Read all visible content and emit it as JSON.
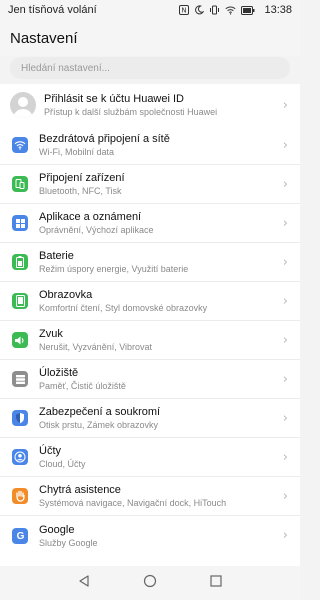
{
  "status_bar": {
    "carrier": "Jen tísňová volání",
    "time": "13:38",
    "icons": [
      "nfc-icon",
      "moon-icon",
      "vibrate-icon",
      "wifi-icon",
      "battery-icon"
    ]
  },
  "header": {
    "title": "Nastavení"
  },
  "search": {
    "placeholder": "Hledání nastavení..."
  },
  "account": {
    "title": "Přihlásit se k účtu Huawei ID",
    "subtitle": "Přístup k další službám společnosti Huawei"
  },
  "items": [
    {
      "label": "Bezdrátová připojení a sítě",
      "sub": "Wi-Fi, Mobilní data",
      "icon": "wifi-icon",
      "color": "#4a86e8"
    },
    {
      "label": "Připojení zařízení",
      "sub": "Bluetooth, NFC, Tisk",
      "icon": "device-connection-icon",
      "color": "#3cba54"
    },
    {
      "label": "Aplikace a oznámení",
      "sub": "Oprávnění, Výchozí aplikace",
      "icon": "apps-icon",
      "color": "#4a86e8"
    },
    {
      "label": "Baterie",
      "sub": "Režim úspory energie, Využití baterie",
      "icon": "battery-icon",
      "color": "#3cba54"
    },
    {
      "label": "Obrazovka",
      "sub": "Komfortní čtení, Styl domovské obrazovky",
      "icon": "display-icon",
      "color": "#3cba54"
    },
    {
      "label": "Zvuk",
      "sub": "Nerušit, Vyzvánění, Vibrovat",
      "icon": "sound-icon",
      "color": "#3cba54"
    },
    {
      "label": "Úložiště",
      "sub": "Paměť, Čistič úložiště",
      "icon": "storage-icon",
      "color": "#8e8e8e"
    },
    {
      "label": "Zabezpečení a soukromí",
      "sub": "Otisk prstu, Zámek obrazovky",
      "icon": "shield-icon",
      "color": "#4a86e8"
    },
    {
      "label": "Účty",
      "sub": "Cloud, Účty",
      "icon": "account-icon",
      "color": "#4a86e8"
    },
    {
      "label": "Chytrá asistence",
      "sub": "Systémová navigace, Navigační dock, HiTouch",
      "icon": "hand-icon",
      "color": "#f28c28"
    },
    {
      "label": "Google",
      "sub": "Služby Google",
      "icon": "google-icon",
      "color": "#4a86e8"
    }
  ],
  "nav": [
    "back-icon",
    "home-icon",
    "recents-icon"
  ]
}
